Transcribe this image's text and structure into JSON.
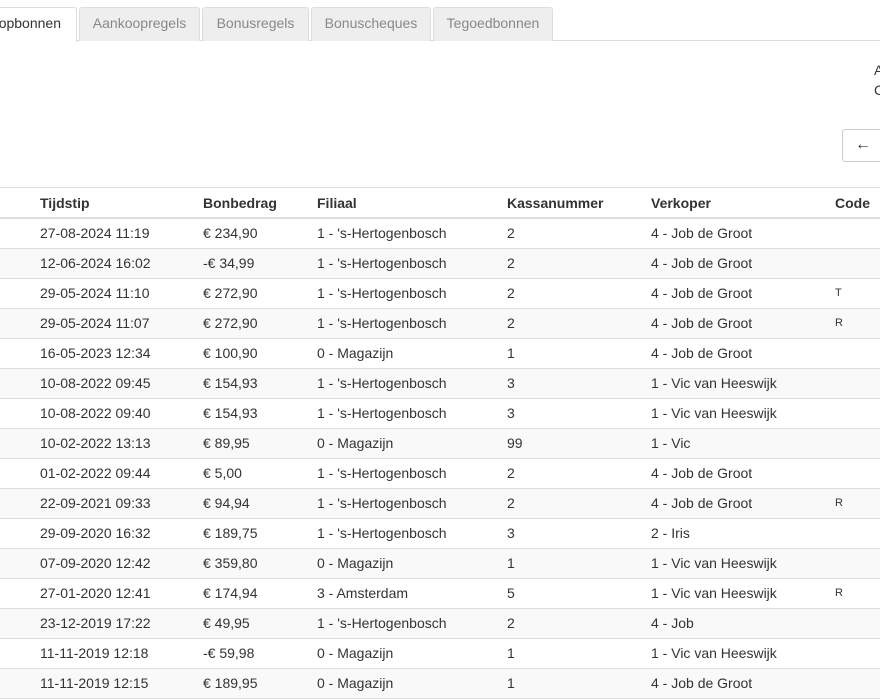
{
  "tabs": [
    {
      "label": "Verkoopbonnen",
      "visible": "opbonnen",
      "active": true
    },
    {
      "label": "Aankoopregels",
      "active": false
    },
    {
      "label": "Bonusregels",
      "active": false
    },
    {
      "label": "Bonuscheques",
      "active": false
    },
    {
      "label": "Tegoedbonnen",
      "active": false
    }
  ],
  "side_info": {
    "line1": "A",
    "line2": "C"
  },
  "nav": {
    "prev_arrow": "←"
  },
  "table": {
    "headers": {
      "time": "Tijdstip",
      "amount": "Bonbedrag",
      "branch": "Filiaal",
      "register": "Kassanummer",
      "seller": "Verkoper",
      "code": "Code"
    },
    "rows": [
      {
        "time": "27-08-2024 11:19",
        "amount": "€ 234,90",
        "branch": "1 - 's-Hertogenbosch",
        "register": "2",
        "seller": "4 - Job de Groot",
        "code": ""
      },
      {
        "time": "12-06-2024 16:02",
        "amount": "-€ 34,99",
        "branch": "1 - 's-Hertogenbosch",
        "register": "2",
        "seller": "4 - Job de Groot",
        "code": ""
      },
      {
        "time": "29-05-2024 11:10",
        "amount": "€ 272,90",
        "branch": "1 - 's-Hertogenbosch",
        "register": "2",
        "seller": "4 - Job de Groot",
        "code": "T"
      },
      {
        "time": "29-05-2024 11:07",
        "amount": "€ 272,90",
        "branch": "1 - 's-Hertogenbosch",
        "register": "2",
        "seller": "4 - Job de Groot",
        "code": "R"
      },
      {
        "time": "16-05-2023 12:34",
        "amount": "€ 100,90",
        "branch": "0 - Magazijn",
        "register": "1",
        "seller": "4 - Job de Groot",
        "code": ""
      },
      {
        "time": "10-08-2022 09:45",
        "amount": "€ 154,93",
        "branch": "1 - 's-Hertogenbosch",
        "register": "3",
        "seller": "1 - Vic van Heeswijk",
        "code": ""
      },
      {
        "time": "10-08-2022 09:40",
        "amount": "€ 154,93",
        "branch": "1 - 's-Hertogenbosch",
        "register": "3",
        "seller": "1 - Vic van Heeswijk",
        "code": ""
      },
      {
        "time": "10-02-2022 13:13",
        "amount": "€ 89,95",
        "branch": "0 - Magazijn",
        "register": "99",
        "seller": "1 - Vic",
        "code": ""
      },
      {
        "time": "01-02-2022 09:44",
        "amount": "€ 5,00",
        "branch": "1 - 's-Hertogenbosch",
        "register": "2",
        "seller": "4 - Job de Groot",
        "code": ""
      },
      {
        "time": "22-09-2021 09:33",
        "amount": "€ 94,94",
        "branch": "1 - 's-Hertogenbosch",
        "register": "2",
        "seller": "4 - Job de Groot",
        "code": "R"
      },
      {
        "time": "29-09-2020 16:32",
        "amount": "€ 189,75",
        "branch": "1 - 's-Hertogenbosch",
        "register": "3",
        "seller": "2 - Iris",
        "code": ""
      },
      {
        "time": "07-09-2020 12:42",
        "amount": "€ 359,80",
        "branch": "0 - Magazijn",
        "register": "1",
        "seller": "1 - Vic van Heeswijk",
        "code": ""
      },
      {
        "time": "27-01-2020 12:41",
        "amount": "€ 174,94",
        "branch": "3 - Amsterdam",
        "register": "5",
        "seller": "1 - Vic van Heeswijk",
        "code": "R"
      },
      {
        "time": "23-12-2019 17:22",
        "amount": "€ 49,95",
        "branch": "1 - 's-Hertogenbosch",
        "register": "2",
        "seller": "4 - Job",
        "code": ""
      },
      {
        "time": "11-11-2019 12:18",
        "amount": "-€ 59,98",
        "branch": "0 - Magazijn",
        "register": "1",
        "seller": "1 - Vic van Heeswijk",
        "code": ""
      },
      {
        "time": "11-11-2019 12:15",
        "amount": "€ 189,95",
        "branch": "0 - Magazijn",
        "register": "1",
        "seller": "4 - Job de Groot",
        "code": ""
      }
    ]
  }
}
